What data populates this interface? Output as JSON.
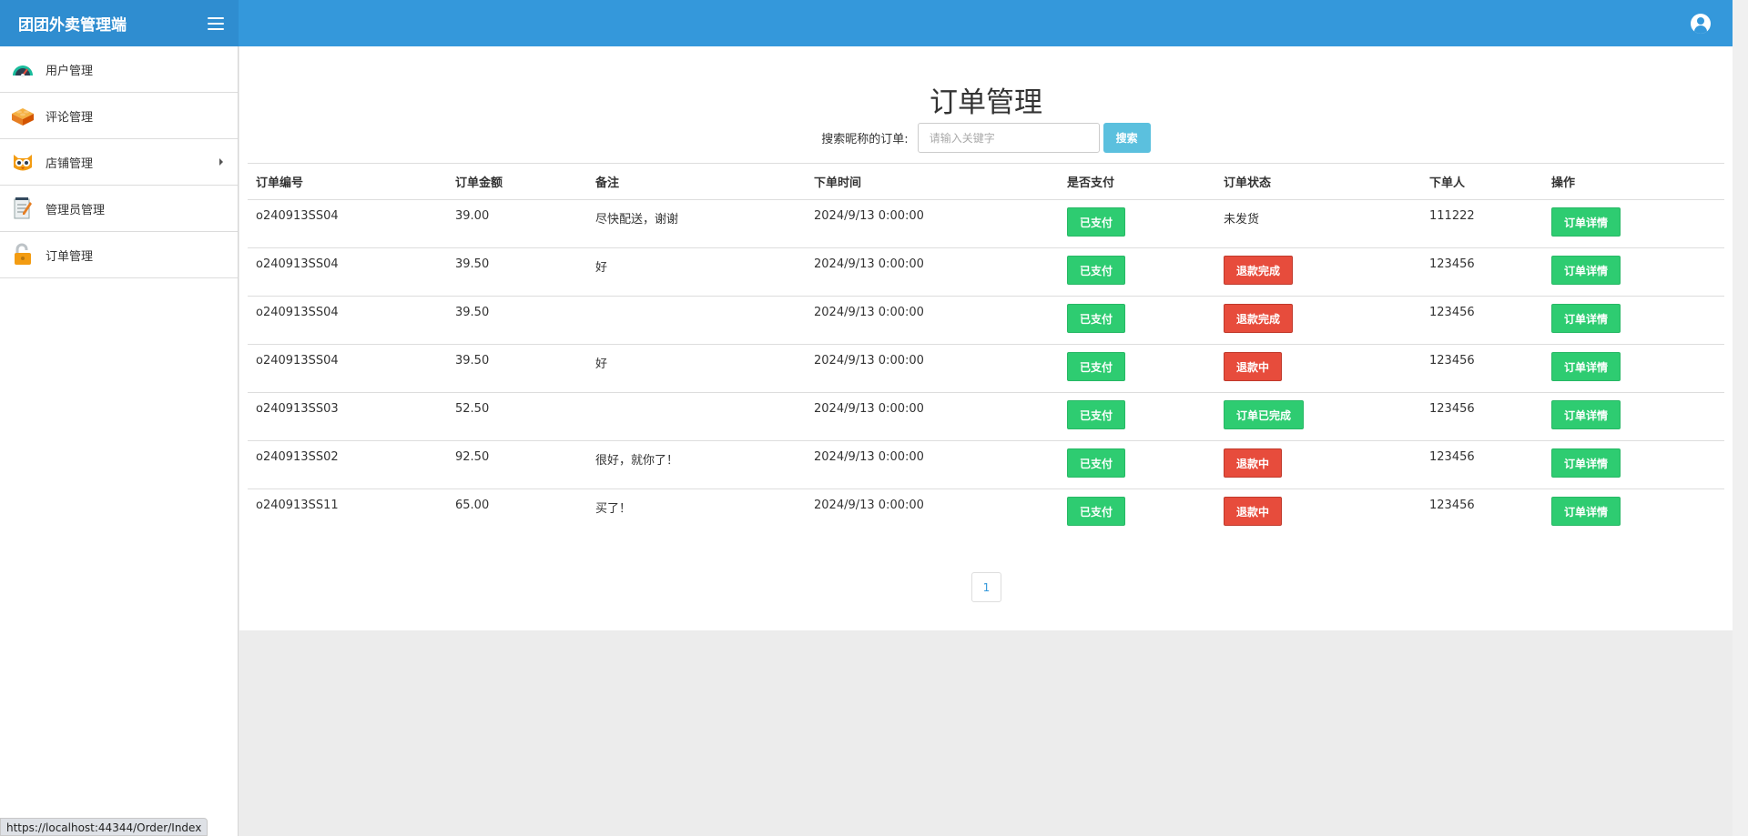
{
  "app": {
    "title": "团团外卖管理端"
  },
  "sidebar": {
    "items": [
      {
        "label": "用户管理",
        "icon": "dashboard-gauge-icon"
      },
      {
        "label": "评论管理",
        "icon": "lego-brick-icon"
      },
      {
        "label": "店铺管理",
        "icon": "owl-icon",
        "has_submenu": true
      },
      {
        "label": "管理员管理",
        "icon": "notepad-icon"
      },
      {
        "label": "订单管理",
        "icon": "open-lock-icon"
      }
    ]
  },
  "page": {
    "title": "订单管理",
    "search_label": "搜索昵称的订单:",
    "search_placeholder": "请输入关键字",
    "search_button": "搜索"
  },
  "table": {
    "headers": [
      "订单编号",
      "订单金额",
      "备注",
      "下单时间",
      "是否支付",
      "订单状态",
      "下单人",
      "操作"
    ],
    "rows": [
      {
        "id": "o240913SS04",
        "amount": "39.00",
        "note": "尽快配送，谢谢",
        "time": "2024/9/13 0:00:00",
        "paid": "已支付",
        "status": "未发货",
        "status_style": "text",
        "user": "111222",
        "action": "订单详情"
      },
      {
        "id": "o240913SS04",
        "amount": "39.50",
        "note": "好",
        "time": "2024/9/13 0:00:00",
        "paid": "已支付",
        "status": "退款完成",
        "status_style": "red",
        "user": "123456",
        "action": "订单详情"
      },
      {
        "id": "o240913SS04",
        "amount": "39.50",
        "note": "",
        "time": "2024/9/13 0:00:00",
        "paid": "已支付",
        "status": "退款完成",
        "status_style": "red",
        "user": "123456",
        "action": "订单详情"
      },
      {
        "id": "o240913SS04",
        "amount": "39.50",
        "note": "好",
        "time": "2024/9/13 0:00:00",
        "paid": "已支付",
        "status": "退款中",
        "status_style": "red",
        "user": "123456",
        "action": "订单详情"
      },
      {
        "id": "o240913SS03",
        "amount": "52.50",
        "note": "",
        "time": "2024/9/13 0:00:00",
        "paid": "已支付",
        "status": "订单已完成",
        "status_style": "green",
        "user": "123456",
        "action": "订单详情"
      },
      {
        "id": "o240913SS02",
        "amount": "92.50",
        "note": "很好，就你了！",
        "time": "2024/9/13 0:00:00",
        "paid": "已支付",
        "status": "退款中",
        "status_style": "red",
        "user": "123456",
        "action": "订单详情"
      },
      {
        "id": "o240913SS11",
        "amount": "65.00",
        "note": "买了！",
        "time": "2024/9/13 0:00:00",
        "paid": "已支付",
        "status": "退款中",
        "status_style": "red",
        "user": "123456",
        "action": "订单详情"
      }
    ]
  },
  "pagination": {
    "current": "1"
  },
  "status_bar": {
    "url": "https://localhost:44344/Order/Index"
  },
  "colors": {
    "topbar": "#3498db",
    "success": "#2ecc71",
    "danger": "#e74c3c",
    "info": "#5bc0de"
  }
}
